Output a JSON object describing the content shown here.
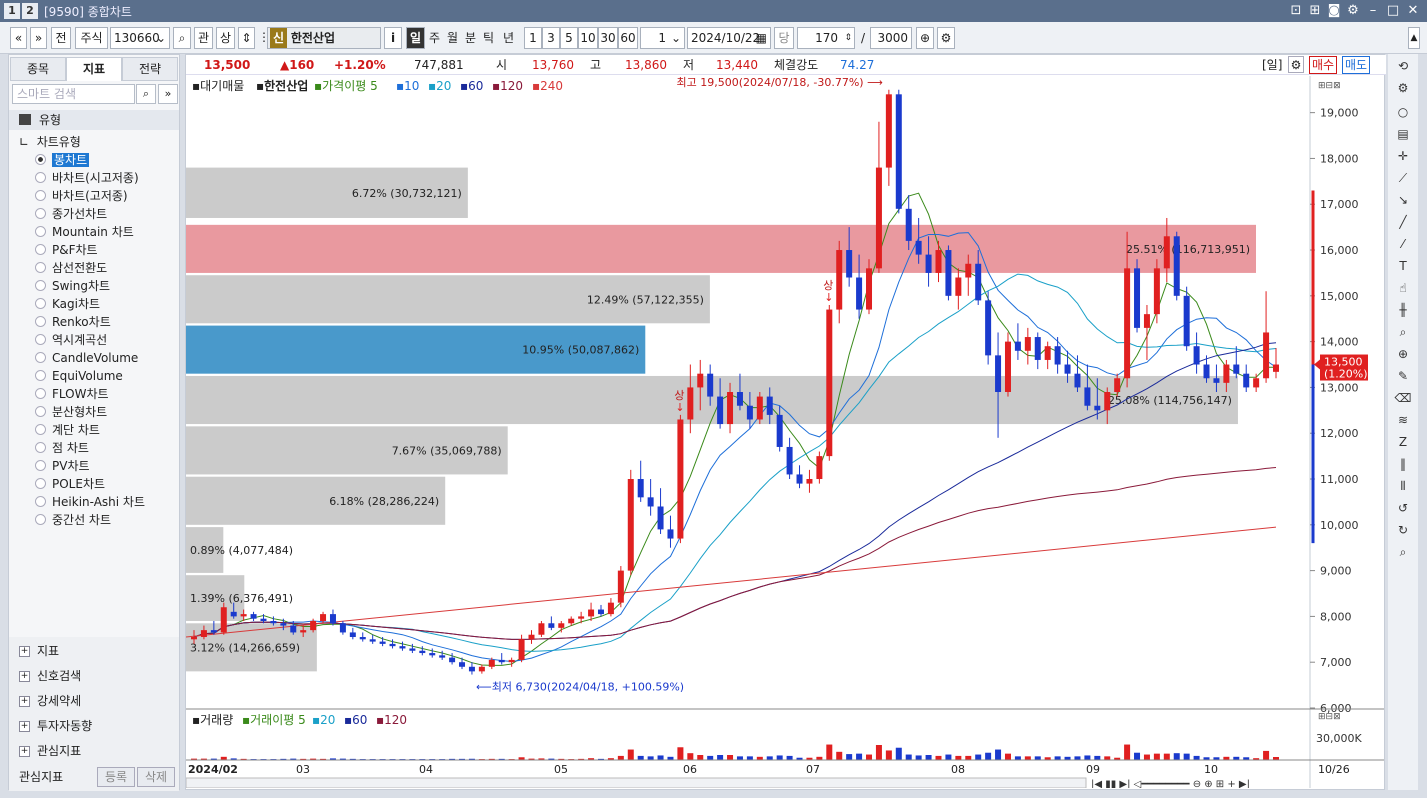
{
  "window": {
    "nums": [
      "1",
      "2"
    ],
    "title": "[9590] 종합차트"
  },
  "toolbar": {
    "market": "주식",
    "code": "130660",
    "btn_prev": "«",
    "btn_down": "»",
    "btn_jeon": "전",
    "btn_gwan": "관",
    "btn_sang": "상",
    "badge": "신",
    "stock_name": "한전산업",
    "info": "i",
    "periods": [
      "일",
      "주",
      "월",
      "분",
      "틱",
      "년"
    ],
    "active_period": "일",
    "minutes": [
      "1",
      "3",
      "5",
      "10",
      "30",
      "60"
    ],
    "unit_value": "1",
    "date": "2024/10/22",
    "dang": "당",
    "count": "170",
    "slash": "/",
    "total": "3000"
  },
  "left_panel": {
    "tabs": [
      "종목",
      "지표",
      "전략"
    ],
    "active_tab": "지표",
    "search_placeholder": "스마트 검색",
    "header": "유형",
    "group_title": "차트유형",
    "chart_types": [
      "봉차트",
      "바차트(시고저종)",
      "바차트(고저종)",
      "종가선차트",
      "Mountain 차트",
      "P&F차트",
      "삼선전환도",
      "Swing차트",
      "Kagi차트",
      "Renko차트",
      "역시계곡선",
      "CandleVolume",
      "EquiVolume",
      "FLOW차트",
      "분산형차트",
      "계단 차트",
      "점 차트",
      "PV차트",
      "POLE차트",
      "Heikin-Ashi 차트",
      "중간선 차트"
    ],
    "selected_type": "봉차트",
    "bottom_groups": [
      "지표",
      "신호검색",
      "강세약세",
      "투자자동향",
      "관심지표"
    ],
    "footer_label": "관심지표",
    "footer_btn1": "등록",
    "footer_btn2": "삭제"
  },
  "price_bar": {
    "price": "13,500",
    "change": "▲160",
    "change_pct": "+1.20%",
    "volume": "747,881",
    "open_label": "시",
    "open": "13,760",
    "high_label": "고",
    "high": "13,860",
    "low_label": "저",
    "low": "13,440",
    "strength_label": "체결강도",
    "strength": "74.27",
    "period_btn": "[일]",
    "buy": "매수",
    "sell": "매도"
  },
  "chart_legend": {
    "main": "대기매물",
    "name": "한전산업",
    "ma_label": "가격이평",
    "ma_periods": [
      "5",
      "10",
      "20",
      "60",
      "120",
      "240"
    ],
    "ma_colors": [
      "#3a8a1a",
      "#1e6fd9",
      "#1aa0c8",
      "#1a2a9a",
      "#8a1a3a",
      "#d83a3a"
    ]
  },
  "chart_data": {
    "type": "candlestick",
    "y_ticks": [
      "19,000",
      "18,000",
      "17,000",
      "16,000",
      "15,000",
      "14,000",
      "13,000",
      "12,000",
      "11,000",
      "10,000",
      "9,000",
      "8,000",
      "7,000",
      "6,000"
    ],
    "ylim": [
      6000,
      19800
    ],
    "x_labels": [
      "2024/02",
      "03",
      "04",
      "05",
      "06",
      "07",
      "08",
      "09",
      "10",
      "10/26"
    ],
    "current_price_label": "13,500",
    "current_pct_label": "(1.20%)",
    "high_annotation": "최고 19,500(2024/07/18, -30.77%)",
    "low_annotation": "최저 6,730(2024/04/18, +100.59%)",
    "sang_marker": "상",
    "volume_profile": [
      {
        "label": "6.72% (30,732,121)",
        "pct": 6.72,
        "low": 16700,
        "high": 17800
      },
      {
        "label": "25.51% (116,713,951)",
        "pct": 25.51,
        "low": 15500,
        "high": 16550
      },
      {
        "label": "12.49% (57,122,355)",
        "pct": 12.49,
        "low": 14400,
        "high": 15450
      },
      {
        "label": "10.95% (50,087,862)",
        "pct": 10.95,
        "low": 13300,
        "high": 14350
      },
      {
        "label": "25.08% (114,756,147)",
        "pct": 25.08,
        "low": 12200,
        "high": 13250
      },
      {
        "label": "7.67% (35,069,788)",
        "pct": 7.67,
        "low": 11100,
        "high": 12150
      },
      {
        "label": "6.18% (28,286,224)",
        "pct": 6.18,
        "low": 10000,
        "high": 11050
      },
      {
        "label": "0.89% (4,077,484)",
        "pct": 0.89,
        "low": 8950,
        "high": 9950
      },
      {
        "label": "1.39% (6,376,491)",
        "pct": 1.39,
        "low": 7900,
        "high": 8900
      },
      {
        "label": "3.12% (14,266,659)",
        "pct": 3.12,
        "low": 6800,
        "high": 7850
      }
    ],
    "candles": [
      [
        7500,
        7700,
        7400,
        7550
      ],
      [
        7550,
        7800,
        7500,
        7700
      ],
      [
        7700,
        7900,
        7600,
        7650
      ],
      [
        7650,
        8300,
        7600,
        8200
      ],
      [
        8100,
        8300,
        7950,
        8000
      ],
      [
        8000,
        8150,
        7900,
        8050
      ],
      [
        8050,
        8100,
        7900,
        7950
      ],
      [
        7950,
        8050,
        7850,
        7900
      ],
      [
        7900,
        8000,
        7800,
        7850
      ],
      [
        7850,
        7950,
        7700,
        7800
      ],
      [
        7800,
        7900,
        7600,
        7650
      ],
      [
        7650,
        7800,
        7550,
        7700
      ],
      [
        7700,
        7950,
        7650,
        7900
      ],
      [
        7900,
        8100,
        7850,
        8050
      ],
      [
        8050,
        8150,
        7800,
        7850
      ],
      [
        7850,
        7900,
        7600,
        7650
      ],
      [
        7650,
        7750,
        7500,
        7550
      ],
      [
        7550,
        7650,
        7450,
        7500
      ],
      [
        7500,
        7600,
        7400,
        7450
      ],
      [
        7450,
        7550,
        7350,
        7400
      ],
      [
        7400,
        7500,
        7300,
        7350
      ],
      [
        7350,
        7450,
        7250,
        7300
      ],
      [
        7300,
        7400,
        7200,
        7250
      ],
      [
        7250,
        7350,
        7150,
        7200
      ],
      [
        7200,
        7300,
        7100,
        7150
      ],
      [
        7150,
        7250,
        7050,
        7100
      ],
      [
        7100,
        7200,
        6950,
        7000
      ],
      [
        7000,
        7100,
        6850,
        6900
      ],
      [
        6900,
        7000,
        6730,
        6800
      ],
      [
        6800,
        6950,
        6750,
        6900
      ],
      [
        6900,
        7100,
        6850,
        7050
      ],
      [
        7050,
        7200,
        6950,
        7000
      ],
      [
        7000,
        7100,
        6900,
        7050
      ],
      [
        7050,
        7600,
        7000,
        7500
      ],
      [
        7500,
        7700,
        7400,
        7600
      ],
      [
        7600,
        7900,
        7550,
        7850
      ],
      [
        7850,
        8000,
        7700,
        7750
      ],
      [
        7750,
        7900,
        7650,
        7850
      ],
      [
        7850,
        8000,
        7800,
        7950
      ],
      [
        7950,
        8100,
        7850,
        8000
      ],
      [
        8000,
        8300,
        7900,
        8150
      ],
      [
        8150,
        8250,
        8000,
        8050
      ],
      [
        8050,
        8400,
        8000,
        8300
      ],
      [
        8300,
        9100,
        8200,
        9000
      ],
      [
        9000,
        11200,
        8900,
        11000
      ],
      [
        11000,
        11400,
        10500,
        10600
      ],
      [
        10600,
        11000,
        10200,
        10400
      ],
      [
        10400,
        10800,
        9800,
        9900
      ],
      [
        9900,
        10200,
        9500,
        9700
      ],
      [
        9700,
        12400,
        9600,
        12300
      ],
      [
        12300,
        13500,
        12000,
        13000
      ],
      [
        13000,
        13600,
        12500,
        13300
      ],
      [
        13300,
        13500,
        12600,
        12800
      ],
      [
        12800,
        13200,
        12100,
        12200
      ],
      [
        12200,
        13100,
        12000,
        12900
      ],
      [
        12900,
        13300,
        12500,
        12600
      ],
      [
        12600,
        12900,
        12100,
        12300
      ],
      [
        12300,
        12900,
        12200,
        12800
      ],
      [
        12800,
        13000,
        12200,
        12400
      ],
      [
        12400,
        12600,
        11600,
        11700
      ],
      [
        11700,
        11900,
        11000,
        11100
      ],
      [
        11100,
        11300,
        10800,
        10900
      ],
      [
        10900,
        11200,
        10700,
        11000
      ],
      [
        11000,
        11600,
        10900,
        11500
      ],
      [
        11500,
        14800,
        11400,
        14700
      ],
      [
        14700,
        16200,
        14400,
        16000
      ],
      [
        16000,
        16500,
        15200,
        15400
      ],
      [
        15400,
        15900,
        14500,
        14700
      ],
      [
        14700,
        15800,
        14600,
        15600
      ],
      [
        15600,
        18800,
        15500,
        17800
      ],
      [
        17800,
        19500,
        17400,
        19400
      ],
      [
        19400,
        19500,
        16800,
        16900
      ],
      [
        16900,
        17200,
        16000,
        16200
      ],
      [
        16200,
        16700,
        15700,
        15900
      ],
      [
        15900,
        16300,
        15200,
        15500
      ],
      [
        15500,
        16200,
        15300,
        16000
      ],
      [
        16000,
        16100,
        14900,
        15000
      ],
      [
        15000,
        15600,
        14700,
        15400
      ],
      [
        15400,
        15900,
        15000,
        15700
      ],
      [
        15700,
        16000,
        14800,
        14900
      ],
      [
        14900,
        15100,
        13500,
        13700
      ],
      [
        13700,
        14200,
        11900,
        12900
      ],
      [
        12900,
        14200,
        12800,
        14000
      ],
      [
        14000,
        14400,
        13600,
        13800
      ],
      [
        13800,
        14300,
        13500,
        14100
      ],
      [
        14100,
        14200,
        13400,
        13600
      ],
      [
        13600,
        14000,
        13400,
        13900
      ],
      [
        13900,
        14100,
        13300,
        13500
      ],
      [
        13500,
        13800,
        13100,
        13300
      ],
      [
        13300,
        13700,
        12900,
        13000
      ],
      [
        13000,
        13500,
        12500,
        12600
      ],
      [
        12600,
        13200,
        12300,
        12500
      ],
      [
        12500,
        13000,
        12200,
        12900
      ],
      [
        12900,
        13300,
        12800,
        13200
      ],
      [
        13200,
        16400,
        13000,
        15600
      ],
      [
        15600,
        15800,
        14200,
        14300
      ],
      [
        14300,
        14800,
        13600,
        14600
      ],
      [
        14600,
        15800,
        14400,
        15600
      ],
      [
        15600,
        16700,
        15300,
        16300
      ],
      [
        16300,
        16400,
        14900,
        15000
      ],
      [
        15000,
        15200,
        13800,
        13900
      ],
      [
        13900,
        14200,
        13300,
        13500
      ],
      [
        13500,
        13700,
        13100,
        13200
      ],
      [
        13200,
        13500,
        12900,
        13100
      ],
      [
        13100,
        13600,
        12900,
        13500
      ],
      [
        13500,
        13900,
        13200,
        13300
      ],
      [
        13300,
        13500,
        12900,
        13000
      ],
      [
        13000,
        13300,
        12900,
        13200
      ],
      [
        13200,
        15100,
        13100,
        14200
      ],
      [
        13340,
        13860,
        13200,
        13500
      ]
    ],
    "volume_ticks": [
      "30,000K"
    ],
    "volume_legend": {
      "label": "거래량",
      "ma_label": "거래이평",
      "periods": [
        "5",
        "20",
        "60",
        "120"
      ]
    }
  }
}
